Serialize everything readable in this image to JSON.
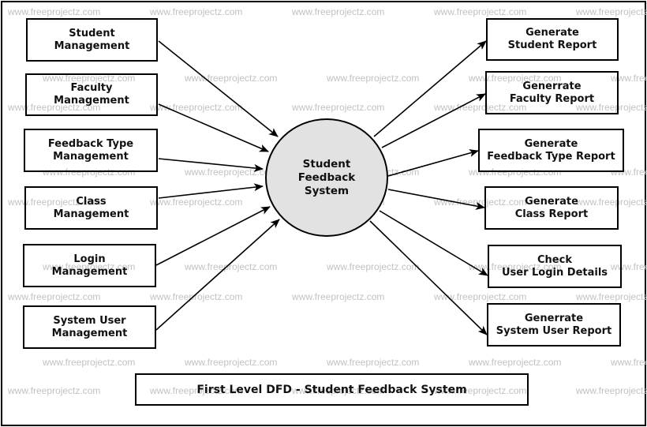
{
  "diagram": {
    "type": "Data Flow Diagram (Level 1)",
    "caption": "First Level DFD - Student Feedback System",
    "central_process": {
      "label": "Student\nFeedback\nSystem",
      "fill": "#e2e2e2"
    },
    "inputs": [
      {
        "id": "student-management",
        "label": "Student\nManagement"
      },
      {
        "id": "faculty-management",
        "label": "Faculty\nManagement"
      },
      {
        "id": "feedback-type-management",
        "label": "Feedback Type\nManagement"
      },
      {
        "id": "class-management",
        "label": "Class\nManagement"
      },
      {
        "id": "login-management",
        "label": "Login\nManagement"
      },
      {
        "id": "system-user-management",
        "label": "System User\nManagement"
      }
    ],
    "outputs": [
      {
        "id": "generate-student-report",
        "label": "Generate\nStudent Report"
      },
      {
        "id": "generate-faculty-report",
        "label": "Generrate\nFaculty Report"
      },
      {
        "id": "generate-feedback-type-report",
        "label": "Generate\nFeedback Type Report"
      },
      {
        "id": "generate-class-report",
        "label": "Generate\nClass Report"
      },
      {
        "id": "check-user-login-details",
        "label": "Check\nUser Login Details"
      },
      {
        "id": "generate-system-user-report",
        "label": "Generrate\nSystem User Report"
      }
    ],
    "edges": [
      {
        "from": "student-management",
        "to": "central_process"
      },
      {
        "from": "faculty-management",
        "to": "central_process"
      },
      {
        "from": "feedback-type-management",
        "to": "central_process"
      },
      {
        "from": "class-management",
        "to": "central_process"
      },
      {
        "from": "login-management",
        "to": "central_process"
      },
      {
        "from": "system-user-management",
        "to": "central_process"
      },
      {
        "from": "central_process",
        "to": "generate-student-report"
      },
      {
        "from": "central_process",
        "to": "generate-faculty-report"
      },
      {
        "from": "central_process",
        "to": "generate-feedback-type-report"
      },
      {
        "from": "central_process",
        "to": "generate-class-report"
      },
      {
        "from": "central_process",
        "to": "check-user-login-details"
      },
      {
        "from": "central_process",
        "to": "generate-system-user-report"
      }
    ]
  },
  "watermark": {
    "text": "www.freeprojectz.com",
    "color": "#c2c2c2"
  }
}
